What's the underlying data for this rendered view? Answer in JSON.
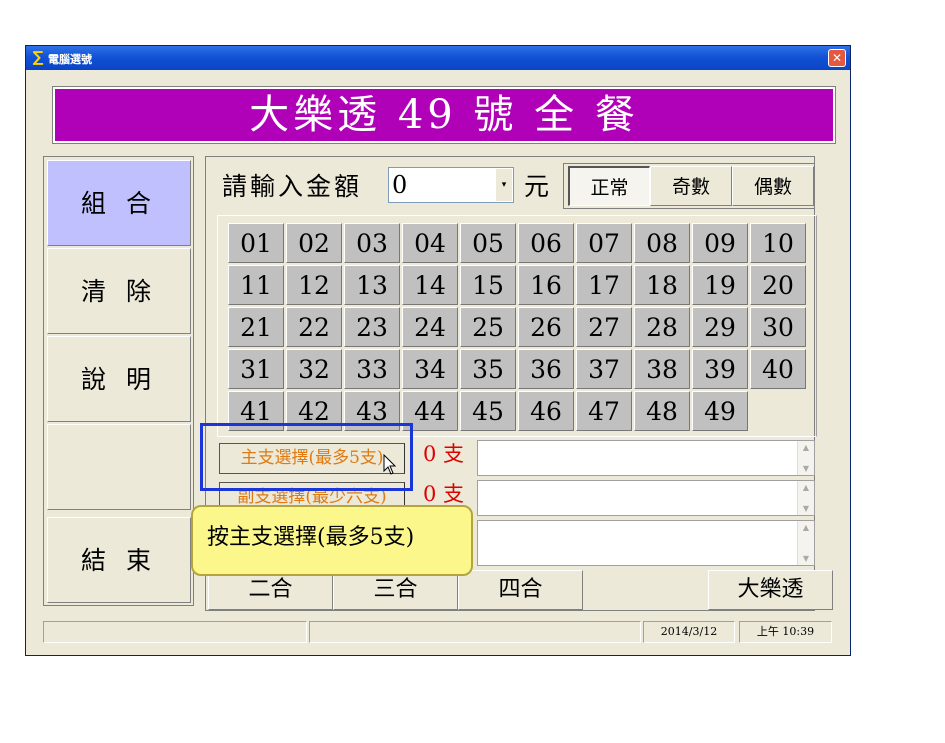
{
  "window": {
    "title": "電腦選號",
    "close_glyph": "✕",
    "app_icon_glyph": "∑"
  },
  "banner": "大樂透 49 號 全 餐",
  "sidebar": [
    {
      "label": "組 合",
      "active": true
    },
    {
      "label": "清 除",
      "active": false
    },
    {
      "label": "說 明",
      "active": false
    },
    {
      "label": "",
      "active": false
    },
    {
      "label": "結 束",
      "active": false
    }
  ],
  "amount": {
    "label": "請輸入金額",
    "value": "0",
    "unit": "元",
    "dropdown_glyph": "▾"
  },
  "modes": [
    {
      "label": "正常",
      "pressed": true
    },
    {
      "label": "奇數",
      "pressed": false
    },
    {
      "label": "偶數",
      "pressed": false
    }
  ],
  "numbers": [
    "01",
    "02",
    "03",
    "04",
    "05",
    "06",
    "07",
    "08",
    "09",
    "10",
    "11",
    "12",
    "13",
    "14",
    "15",
    "16",
    "17",
    "18",
    "19",
    "20",
    "21",
    "22",
    "23",
    "24",
    "25",
    "26",
    "27",
    "28",
    "29",
    "30",
    "31",
    "32",
    "33",
    "34",
    "35",
    "36",
    "37",
    "38",
    "39",
    "40",
    "41",
    "42",
    "43",
    "44",
    "45",
    "46",
    "47",
    "48",
    "49"
  ],
  "selections": [
    {
      "label": "主支選擇(最多5支)",
      "count": "0 支"
    },
    {
      "label": "副支選擇(最少六支)",
      "count": "0 支"
    }
  ],
  "combos": [
    "二合",
    "三合",
    "四合",
    "大樂透"
  ],
  "status": {
    "cell1": "",
    "cell2": "",
    "date": "2014/3/12",
    "time": "上午 10:39"
  },
  "callout": "按主支選擇(最多5支)",
  "colors": {
    "banner": "#b000b8",
    "active_side": "#c0c0ff",
    "number_bg": "#c0c0c0",
    "count_text": "#e00000",
    "highlight": "#1a35d8",
    "callout_bg": "#fbf78a"
  }
}
